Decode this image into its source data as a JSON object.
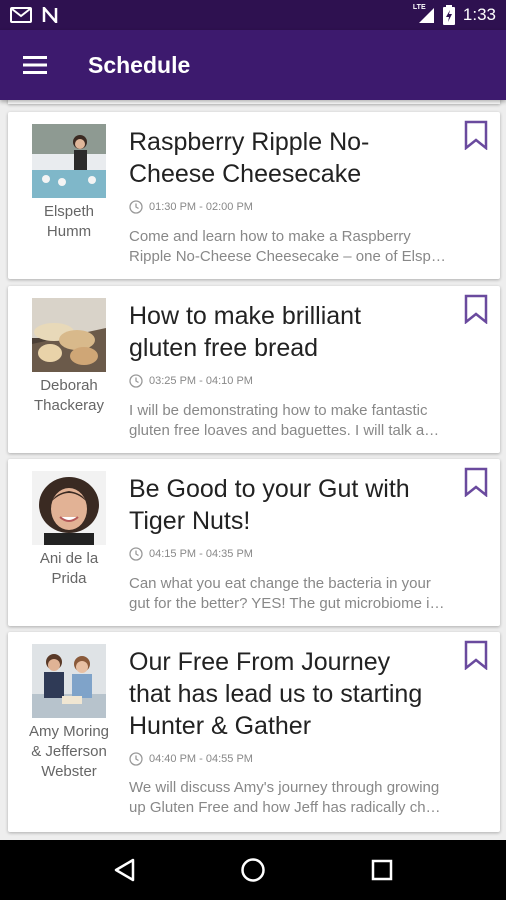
{
  "status_bar": {
    "time": "1:33",
    "lte": "LTE",
    "left_icons": [
      "mail-icon",
      "n-icon"
    ],
    "right_icons": [
      "signal-icon",
      "battery-icon"
    ]
  },
  "app_bar": {
    "title": "Schedule",
    "menu_icon": "hamburger-menu-icon"
  },
  "sessions": [
    {
      "title": "Raspberry Ripple No-Cheese Cheesecake",
      "title_lines": [
        "Raspberry Ripple No-",
        "Cheese Cheesecake"
      ],
      "speaker_lines": [
        "Elspeth",
        "Humm"
      ],
      "time": "01:30 PM - 02:00 PM",
      "desc_lines": [
        "Come and learn how to make a Raspberry",
        "Ripple No-Cheese Cheesecake – one of Elsp…"
      ],
      "bookmarked": false
    },
    {
      "title": "How to make brilliant gluten free bread",
      "title_lines": [
        "How to make brilliant",
        "gluten free bread"
      ],
      "speaker_lines": [
        "Deborah",
        "Thackeray"
      ],
      "time": "03:25 PM - 04:10 PM",
      "desc_lines": [
        "I will be demonstrating how to make fantastic",
        "gluten free loaves and baguettes. I will talk a…"
      ],
      "bookmarked": false
    },
    {
      "title": "Be Good to your Gut with Tiger Nuts!",
      "title_lines": [
        "Be Good to your Gut with",
        "Tiger Nuts!"
      ],
      "speaker_lines": [
        "Ani de la",
        "Prida"
      ],
      "time": "04:15 PM - 04:35 PM",
      "desc_lines": [
        "Can what you eat change the bacteria in your",
        "gut for the better? YES! The gut microbiome i…"
      ],
      "bookmarked": false
    },
    {
      "title": "Our Free From Journey that has lead us to starting Hunter & Gather",
      "title_lines": [
        "Our Free From Journey",
        "that has lead us to starting",
        "Hunter & Gather"
      ],
      "speaker_lines": [
        "Amy Moring",
        "& Jefferson",
        "Webster"
      ],
      "time": "04:40 PM - 04:55 PM",
      "desc_lines": [
        "We will discuss Amy's journey through growing",
        "up Gluten Free and how Jeff has radically ch…"
      ],
      "bookmarked": false
    }
  ],
  "nav_bar": {
    "buttons": [
      "back-icon",
      "home-icon",
      "recents-icon"
    ]
  },
  "colors": {
    "status_bar": "#2e1150",
    "app_bar": "#3d1a6e",
    "bookmark": "#6a4a9e",
    "background": "#eeeeee",
    "nav_bar": "#000000"
  }
}
